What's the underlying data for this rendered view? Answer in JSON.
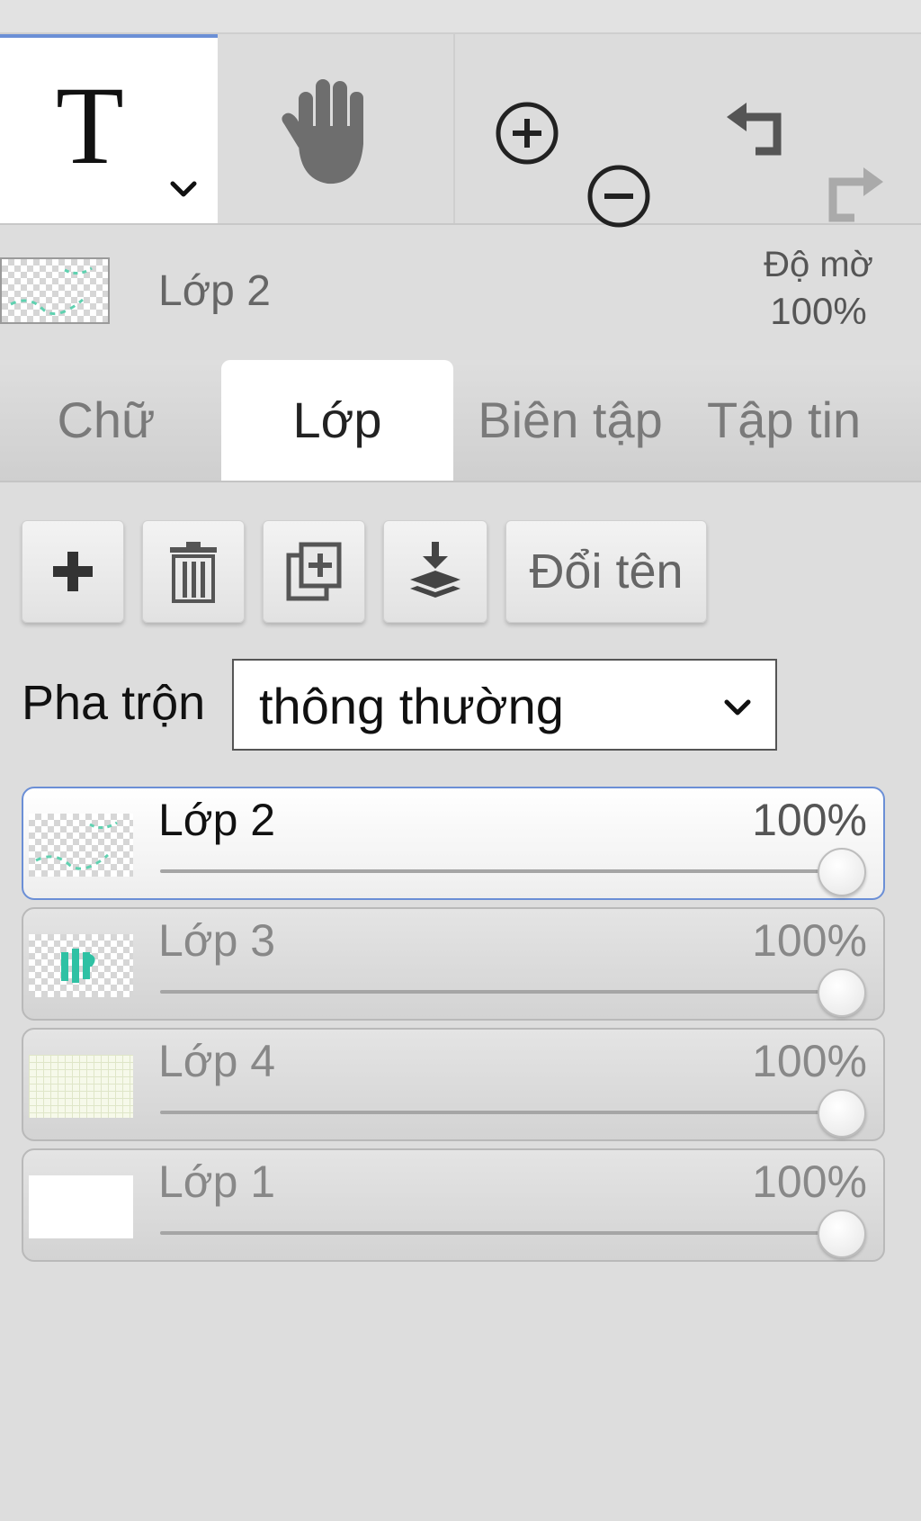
{
  "toolbar": {
    "active_tool_glyph": "T",
    "active_tool_icon": "text-tool-icon",
    "icons": [
      "text-tool-icon",
      "hand-icon",
      "zoom-in-icon",
      "zoom-out-icon",
      "undo-icon",
      "redo-icon"
    ]
  },
  "layer_header": {
    "name": "Lớp 2",
    "opacity_label": "Độ mờ",
    "opacity_value": "100%"
  },
  "tabs": [
    {
      "label": "Chữ",
      "active": false
    },
    {
      "label": "Lớp",
      "active": true
    },
    {
      "label": "Biên tập",
      "active": false
    },
    {
      "label": "Tập tin",
      "active": false
    }
  ],
  "actions": {
    "icons": [
      "plus-icon",
      "trash-icon",
      "duplicate-icon",
      "merge-down-icon"
    ],
    "rename_label": "Đổi tên"
  },
  "blend": {
    "label": "Pha trộn",
    "selected": "thông thường"
  },
  "layers": [
    {
      "name": "Lớp 2",
      "opacity_label": "100%",
      "opacity": 1.0,
      "selected": true
    },
    {
      "name": "Lớp 3",
      "opacity_label": "100%",
      "opacity": 1.0,
      "selected": false
    },
    {
      "name": "Lớp 4",
      "opacity_label": "100%",
      "opacity": 1.0,
      "selected": false
    },
    {
      "name": "Lớp 1",
      "opacity_label": "100%",
      "opacity": 1.0,
      "selected": false
    }
  ],
  "colors": {
    "accent": "#6b8fd6",
    "panel_bg": "#dddddd"
  }
}
